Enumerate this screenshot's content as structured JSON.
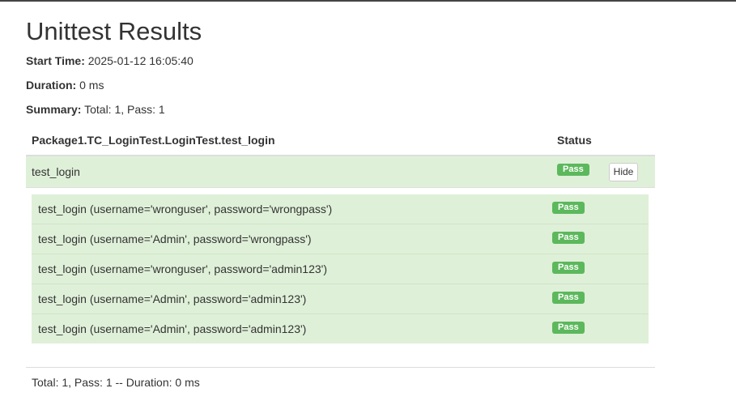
{
  "report": {
    "title": "Unittest Results",
    "start_time_label": "Start Time:",
    "start_time_value": "2025-01-12 16:05:40",
    "duration_label": "Duration:",
    "duration_value": "0 ms",
    "summary_label": "Summary:",
    "summary_value": "Total: 1, Pass: 1"
  },
  "table": {
    "header_name": "Package1.TC_LoginTest.LoginTest.test_login",
    "header_status": "Status",
    "group": {
      "name": "test_login",
      "status": "Pass",
      "toggle_label": "Hide"
    },
    "cases": [
      {
        "name": "test_login (username='wronguser', password='wrongpass')",
        "status": "Pass"
      },
      {
        "name": "test_login (username='Admin', password='wrongpass')",
        "status": "Pass"
      },
      {
        "name": "test_login (username='wronguser', password='admin123')",
        "status": "Pass"
      },
      {
        "name": "test_login (username='Admin', password='admin123')",
        "status": "Pass"
      },
      {
        "name": "test_login (username='Admin', password='admin123')",
        "status": "Pass"
      }
    ]
  },
  "footer": {
    "text": "Total: 1, Pass: 1 -- Duration: 0 ms"
  },
  "colors": {
    "pass_badge": "#5cb85c",
    "row_pass_bg": "#dff0d8",
    "top_border": "#444444"
  }
}
